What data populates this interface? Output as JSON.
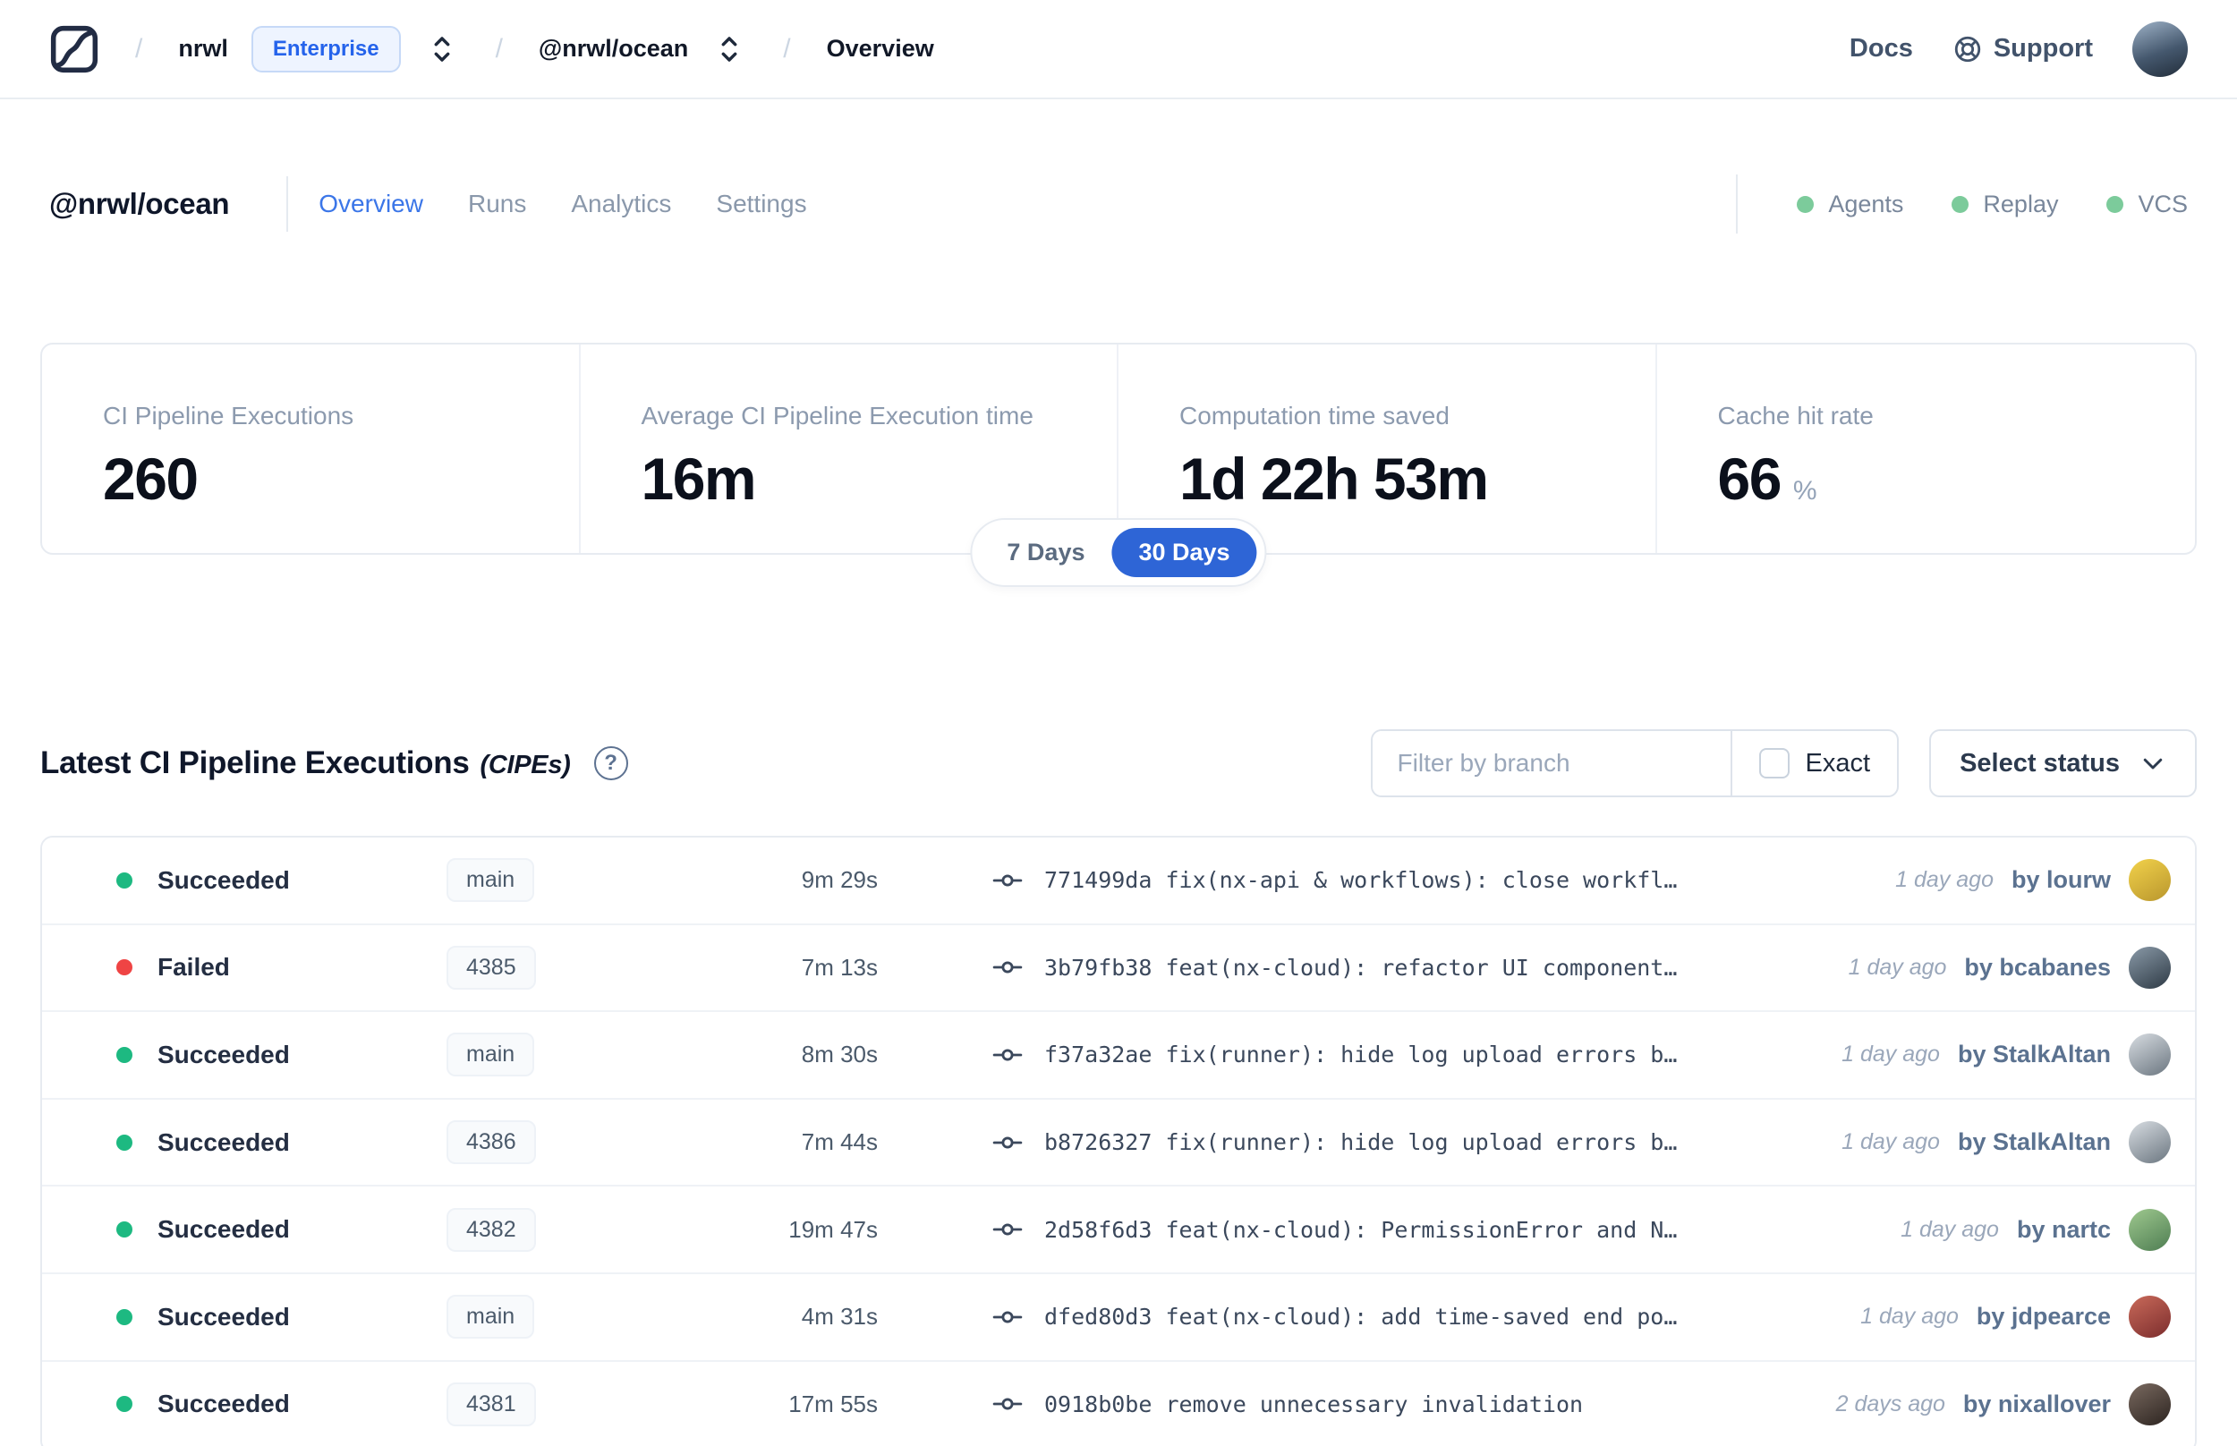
{
  "header": {
    "separator": "/",
    "breadcrumb": {
      "org": "nrwl",
      "org_badge": "Enterprise",
      "workspace": "@nrwl/ocean",
      "page": "Overview"
    },
    "nav": {
      "docs": "Docs",
      "support": "Support"
    }
  },
  "workspace": {
    "title": "@nrwl/ocean",
    "tabs": [
      {
        "label": "Overview",
        "active": true
      },
      {
        "label": "Runs",
        "active": false
      },
      {
        "label": "Analytics",
        "active": false
      },
      {
        "label": "Settings",
        "active": false
      }
    ],
    "integrations": [
      {
        "label": "Agents",
        "dot_color": "#7ccb9b"
      },
      {
        "label": "Replay",
        "dot_color": "#7ccb9b"
      },
      {
        "label": "VCS",
        "dot_color": "#7ccb9b"
      }
    ]
  },
  "stats": {
    "cards": [
      {
        "label": "CI Pipeline Executions",
        "value": "260",
        "suffix": ""
      },
      {
        "label": "Average CI Pipeline Execution time",
        "value": "16m",
        "suffix": ""
      },
      {
        "label": "Computation time saved",
        "value": "1d 22h 53m",
        "suffix": ""
      },
      {
        "label": "Cache hit rate",
        "value": "66",
        "suffix": "%"
      }
    ],
    "range_toggle": {
      "options": [
        "7 Days",
        "30 Days"
      ],
      "selected": "30 Days",
      "active_color": "#2e65d6"
    }
  },
  "cipe_section": {
    "title": "Latest CI Pipeline Executions",
    "title_suffix": "(CIPEs)",
    "filter_placeholder": "Filter by branch",
    "exact_label": "Exact",
    "status_button_label": "Select status",
    "status_colors": {
      "succeeded": "#1db981",
      "failed": "#ef4444"
    },
    "rows": [
      {
        "status": "Succeeded",
        "status_color": "#1db981",
        "branch": "main",
        "duration": "9m 29s",
        "commit": "771499da fix(nx-api & workflows): close workfl…",
        "time": "1 day ago",
        "author": "by lourw",
        "avatar_colors": [
          "#f2d24b",
          "#b9962d"
        ]
      },
      {
        "status": "Failed",
        "status_color": "#ef4444",
        "branch": "4385",
        "duration": "7m 13s",
        "commit": "3b79fb38 feat(nx-cloud): refactor UI component…",
        "time": "1 day ago",
        "author": "by bcabanes",
        "avatar_colors": [
          "#8a9aa8",
          "#2e3a45"
        ]
      },
      {
        "status": "Succeeded",
        "status_color": "#1db981",
        "branch": "main",
        "duration": "8m 30s",
        "commit": "f37a32ae fix(runner): hide log upload errors b…",
        "time": "1 day ago",
        "author": "by StalkAltan",
        "avatar_colors": [
          "#d8dde2",
          "#6b7680"
        ]
      },
      {
        "status": "Succeeded",
        "status_color": "#1db981",
        "branch": "4386",
        "duration": "7m 44s",
        "commit": "b8726327 fix(runner): hide log upload errors b…",
        "time": "1 day ago",
        "author": "by StalkAltan",
        "avatar_colors": [
          "#d8dde2",
          "#6b7680"
        ]
      },
      {
        "status": "Succeeded",
        "status_color": "#1db981",
        "branch": "4382",
        "duration": "19m 47s",
        "commit": "2d58f6d3 feat(nx-cloud): PermissionError and N…",
        "time": "1 day ago",
        "author": "by nartc",
        "avatar_colors": [
          "#9fc98f",
          "#4e7d52"
        ]
      },
      {
        "status": "Succeeded",
        "status_color": "#1db981",
        "branch": "main",
        "duration": "4m 31s",
        "commit": "dfed80d3 feat(nx-cloud): add time-saved end po…",
        "time": "1 day ago",
        "author": "by jdpearce",
        "avatar_colors": [
          "#c96a5a",
          "#7c2d2d"
        ]
      },
      {
        "status": "Succeeded",
        "status_color": "#1db981",
        "branch": "4381",
        "duration": "17m 55s",
        "commit": "0918b0be remove unnecessary invalidation",
        "time": "2 days ago",
        "author": "by nixallover",
        "avatar_colors": [
          "#7a6a60",
          "#2c2420"
        ]
      }
    ]
  }
}
